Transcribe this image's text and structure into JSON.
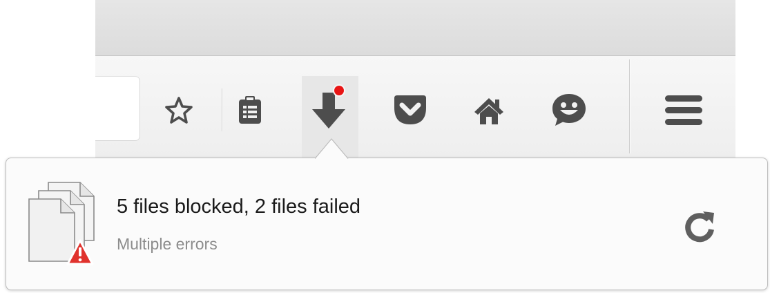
{
  "toolbar": {
    "buttons": [
      {
        "name": "bookmark-star",
        "icon": "star-outline-icon"
      },
      {
        "name": "reading-list",
        "icon": "clipboard-list-icon"
      },
      {
        "name": "downloads",
        "icon": "download-arrow-icon",
        "has_notification": true
      },
      {
        "name": "pocket",
        "icon": "pocket-icon"
      },
      {
        "name": "home",
        "icon": "home-icon"
      },
      {
        "name": "hello-chat",
        "icon": "smiley-chat-icon"
      },
      {
        "name": "menu",
        "icon": "hamburger-menu-icon"
      }
    ],
    "icon_color": "#4d4d4d",
    "notification_color": "#e81414"
  },
  "download_panel": {
    "title": "5 files blocked, 2 files failed",
    "subtitle": "Multiple errors",
    "file_icon": "multiple-files-warning-icon",
    "warning_color": "#e0322d",
    "action_icon": "retry-icon"
  }
}
